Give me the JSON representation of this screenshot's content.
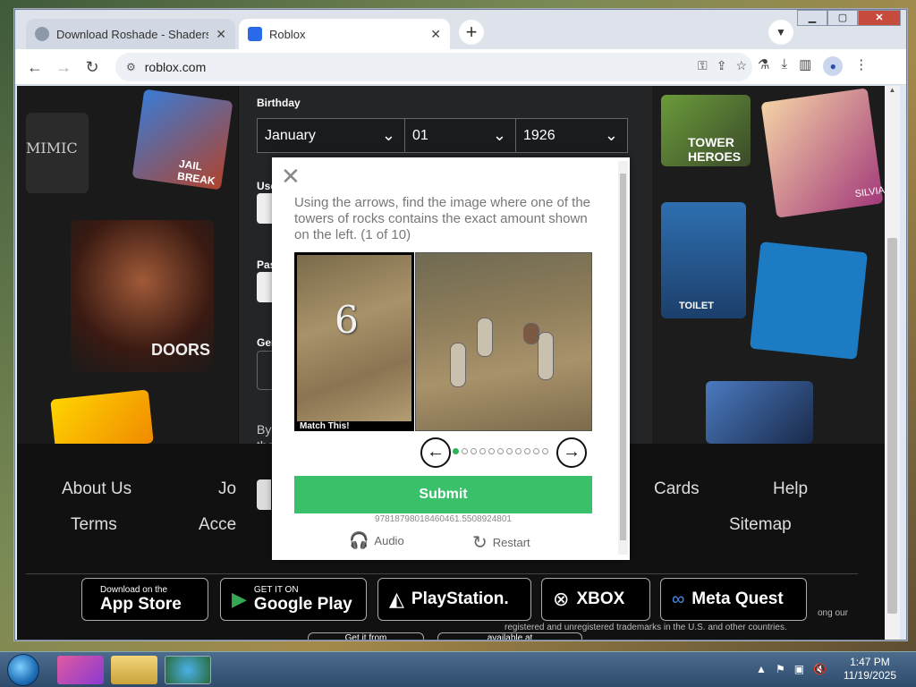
{
  "browser": {
    "tabs": [
      {
        "title": "Download Roshade - Shaders fo",
        "active": false
      },
      {
        "title": "Roblox",
        "active": true
      }
    ],
    "new_tab": "+",
    "url": "roblox.com"
  },
  "signup": {
    "birthday_label": "Birthday",
    "month": "January",
    "day": "01",
    "year": "1926",
    "partial_labels": [
      "Use",
      "Pas",
      "Gen",
      "By",
      "the"
    ],
    "left_art_text": [
      "MIMIC",
      "JAIL BREAK",
      "DOORS"
    ],
    "right_art_text": [
      "TOWER HEROES",
      "TOILET",
      "SILVIA"
    ]
  },
  "captcha": {
    "instruction": "Using the arrows, find the image where one of the towers of rocks contains the exact amount shown on the left. (1 of 10)",
    "ref_number": "6",
    "match_label": "Match This!",
    "dots_total": 11,
    "dots_active": 0,
    "submit_label": "Submit",
    "session_id": "97818798018460461.5508924801",
    "audio_label": "Audio",
    "restart_label": "Restart"
  },
  "footer": {
    "links_row1": [
      "About Us",
      "Jo",
      "Cards",
      "Help"
    ],
    "links_row2": [
      "Terms",
      "Acce",
      "Sitemap"
    ],
    "stores": [
      {
        "small": "Download on the",
        "big": "App Store"
      },
      {
        "small": "GET IT ON",
        "big": "Google Play"
      },
      {
        "small": "",
        "big": "PlayStation."
      },
      {
        "small": "",
        "big": "XBOX"
      },
      {
        "small": "",
        "big": "Meta Quest"
      }
    ],
    "copyright_line1": "ong our",
    "copyright_line2": "registered and unregistered trademarks in the U.S. and other countries.",
    "partial_store": "Get it from",
    "partial_available": "available at"
  },
  "taskbar": {
    "time": "1:47 PM",
    "date": "11/19/2025"
  },
  "colors": {
    "submit_green": "#3abf6a",
    "page_dark": "#111111",
    "form_bg": "#232527"
  }
}
